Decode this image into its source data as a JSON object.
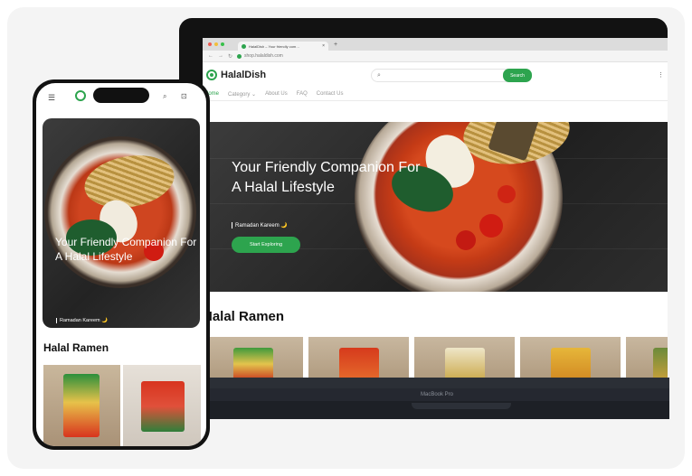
{
  "browser": {
    "tab_title": "HalalDish – Your friendly com…",
    "tab_close": "×",
    "new_tab": "+",
    "url": "shop.halaldish.com"
  },
  "site": {
    "logo_text": "HalalDish",
    "search_button": "Search",
    "nav": [
      "Home",
      "Category ⌄",
      "About Us",
      "FAQ",
      "Contact Us"
    ],
    "hero": {
      "title": "Your Friendly Companion For A Halal Lifestyle",
      "tagline": "Ramadan Kareem 🌙",
      "cta": "Start Exploring"
    },
    "section_title": "Halal Ramen"
  },
  "laptop": {
    "model_label": "MacBook Pro"
  },
  "products": [
    {
      "color": "#4a9a3e"
    },
    {
      "color": "#d63a1c"
    },
    {
      "color": "#efe6c8"
    },
    {
      "color": "#e0b33a"
    },
    {
      "color": "#6b8a3a"
    }
  ],
  "colors": {
    "accent": "#2da44e"
  },
  "icons": [
    "menu-icon",
    "logo-icon",
    "search-icon",
    "cart-icon"
  ]
}
